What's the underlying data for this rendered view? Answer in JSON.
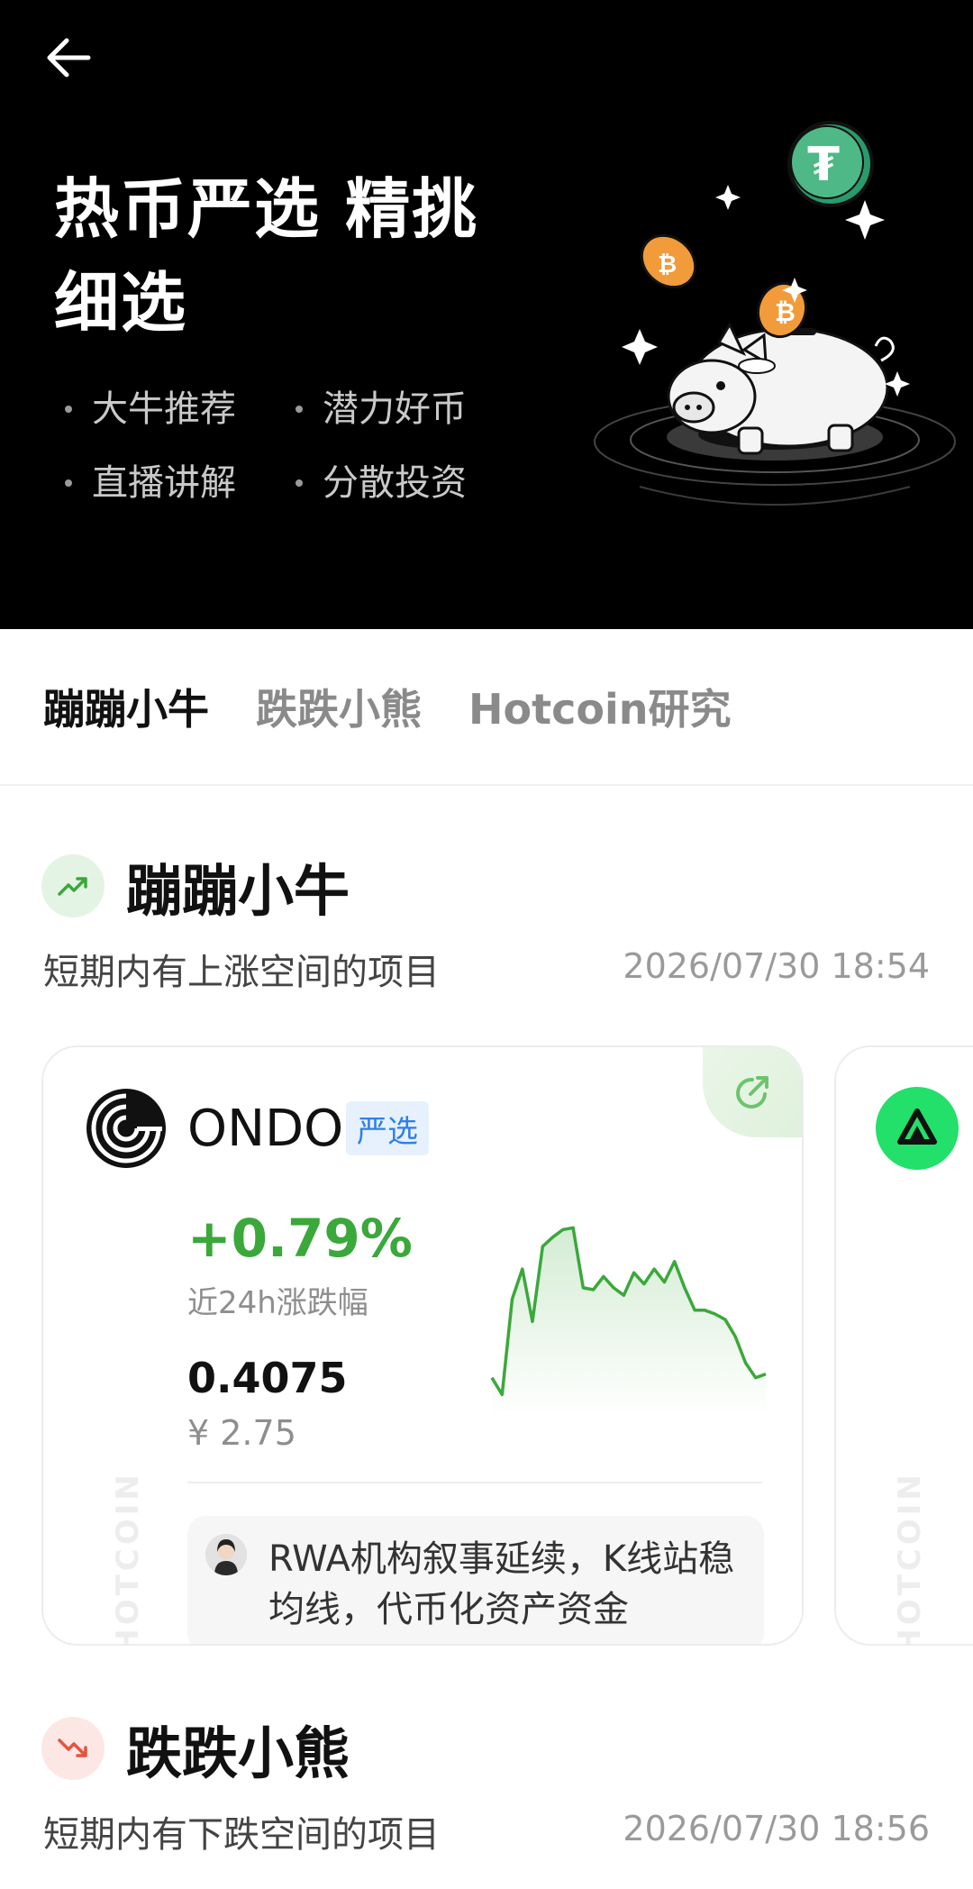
{
  "hero": {
    "title": "热币严选 精挑细选",
    "bullets": [
      "大牛推荐",
      "潜力好币",
      "直播讲解",
      "分散投资"
    ]
  },
  "tabs": [
    "蹦蹦小牛",
    "跌跌小熊",
    "Hotcoin研究"
  ],
  "bull_section": {
    "title": "蹦蹦小牛",
    "subtitle": "短期内有上涨空间的项目",
    "time": "2026/07/30 18:54"
  },
  "coin_card": {
    "name": "ONDO",
    "badge": "严选",
    "change": "+0.79%",
    "change_label": "近24h涨跌幅",
    "price": "0.4075",
    "price_cny": "¥ 2.75",
    "analysis": "RWA机构叙事延续，K线站稳均线，代币化资产资金",
    "watermark": "HOTCOIN",
    "up_color": "#3aa83a"
  },
  "bear_section": {
    "title": "跌跌小熊",
    "subtitle": "短期内有下跌空间的项目",
    "time": "2026/07/30 18:56"
  },
  "chart_data": {
    "type": "line",
    "title": "",
    "xlabel": "",
    "ylabel": "",
    "values": [
      0.8,
      0.35,
      2.9,
      3.7,
      2.3,
      4.3,
      4.55,
      4.75,
      4.8,
      3.2,
      3.15,
      3.5,
      3.2,
      3.0,
      3.6,
      3.3,
      3.7,
      3.35,
      3.9,
      3.2,
      2.6,
      2.6,
      2.5,
      2.35,
      1.9,
      1.2,
      0.8,
      0.9
    ],
    "ylim": [
      0,
      5
    ]
  }
}
